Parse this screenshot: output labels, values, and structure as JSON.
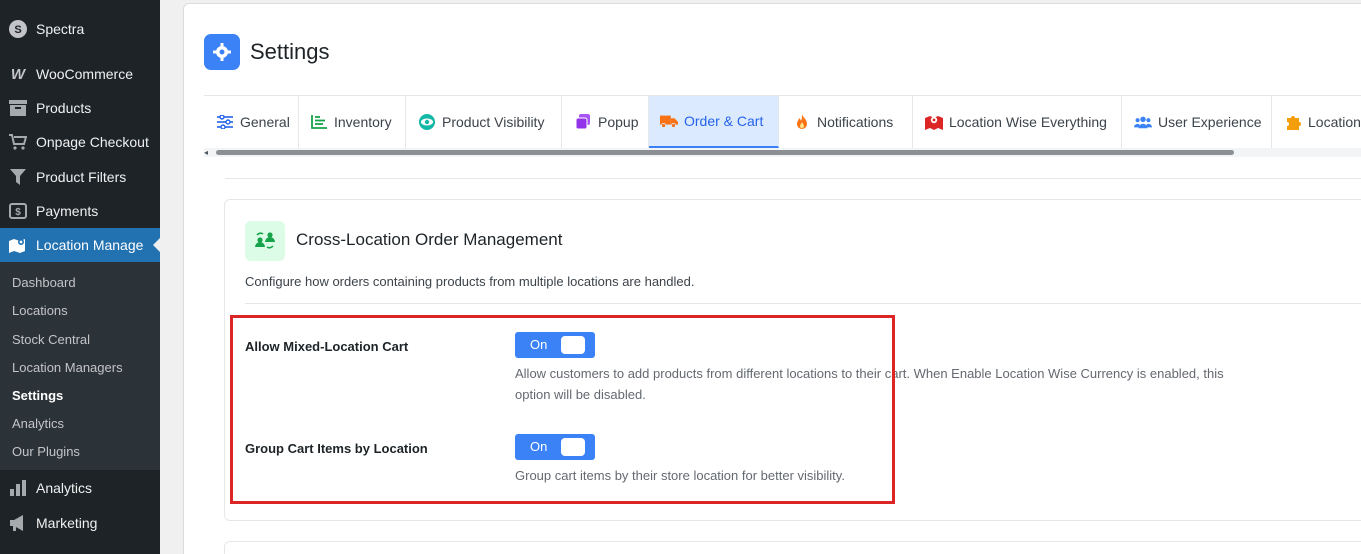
{
  "sidebar": {
    "items": [
      {
        "label": "Spectra",
        "icon": "spectra-icon"
      },
      {
        "label": "WooCommerce",
        "icon": "woo-icon"
      },
      {
        "label": "Products",
        "icon": "archive-icon"
      },
      {
        "label": "Onpage Checkout",
        "icon": "cart-icon"
      },
      {
        "label": "Product Filters",
        "icon": "filter-icon"
      },
      {
        "label": "Payments",
        "icon": "dollar-icon"
      },
      {
        "label": "Location Manage",
        "icon": "map-icon"
      }
    ],
    "submenu": [
      "Dashboard",
      "Locations",
      "Stock Central",
      "Location Managers",
      "Settings",
      "Analytics",
      "Our Plugins"
    ],
    "bottom_items": [
      {
        "label": "Analytics",
        "icon": "bar-chart-icon"
      },
      {
        "label": "Marketing",
        "icon": "megaphone-icon"
      }
    ]
  },
  "page": {
    "title": "Settings"
  },
  "tabs": [
    {
      "label": "General"
    },
    {
      "label": "Inventory"
    },
    {
      "label": "Product Visibility"
    },
    {
      "label": "Popup"
    },
    {
      "label": "Order & Cart"
    },
    {
      "label": "Notifications"
    },
    {
      "label": "Location Wise Everything"
    },
    {
      "label": "User Experience"
    },
    {
      "label": "Location"
    }
  ],
  "section": {
    "title": "Cross-Location Order Management",
    "description": "Configure how orders containing products from multiple locations are handled."
  },
  "fields": [
    {
      "label": "Allow Mixed-Location Cart",
      "toggle": "On",
      "help_line1": "Allow customers to add products from different locations to their cart. When Enable Location Wise Currency is enabled, this",
      "help_line2": "option will be disabled."
    },
    {
      "label": "Group Cart Items by Location",
      "toggle": "On",
      "help_line1": "Group cart items by their store location for better visibility."
    }
  ],
  "colors": {
    "accent": "#3b82f6",
    "highlight": "#dc2626",
    "sidebar_bg": "#1d2327",
    "active_menu": "#2271b1"
  }
}
